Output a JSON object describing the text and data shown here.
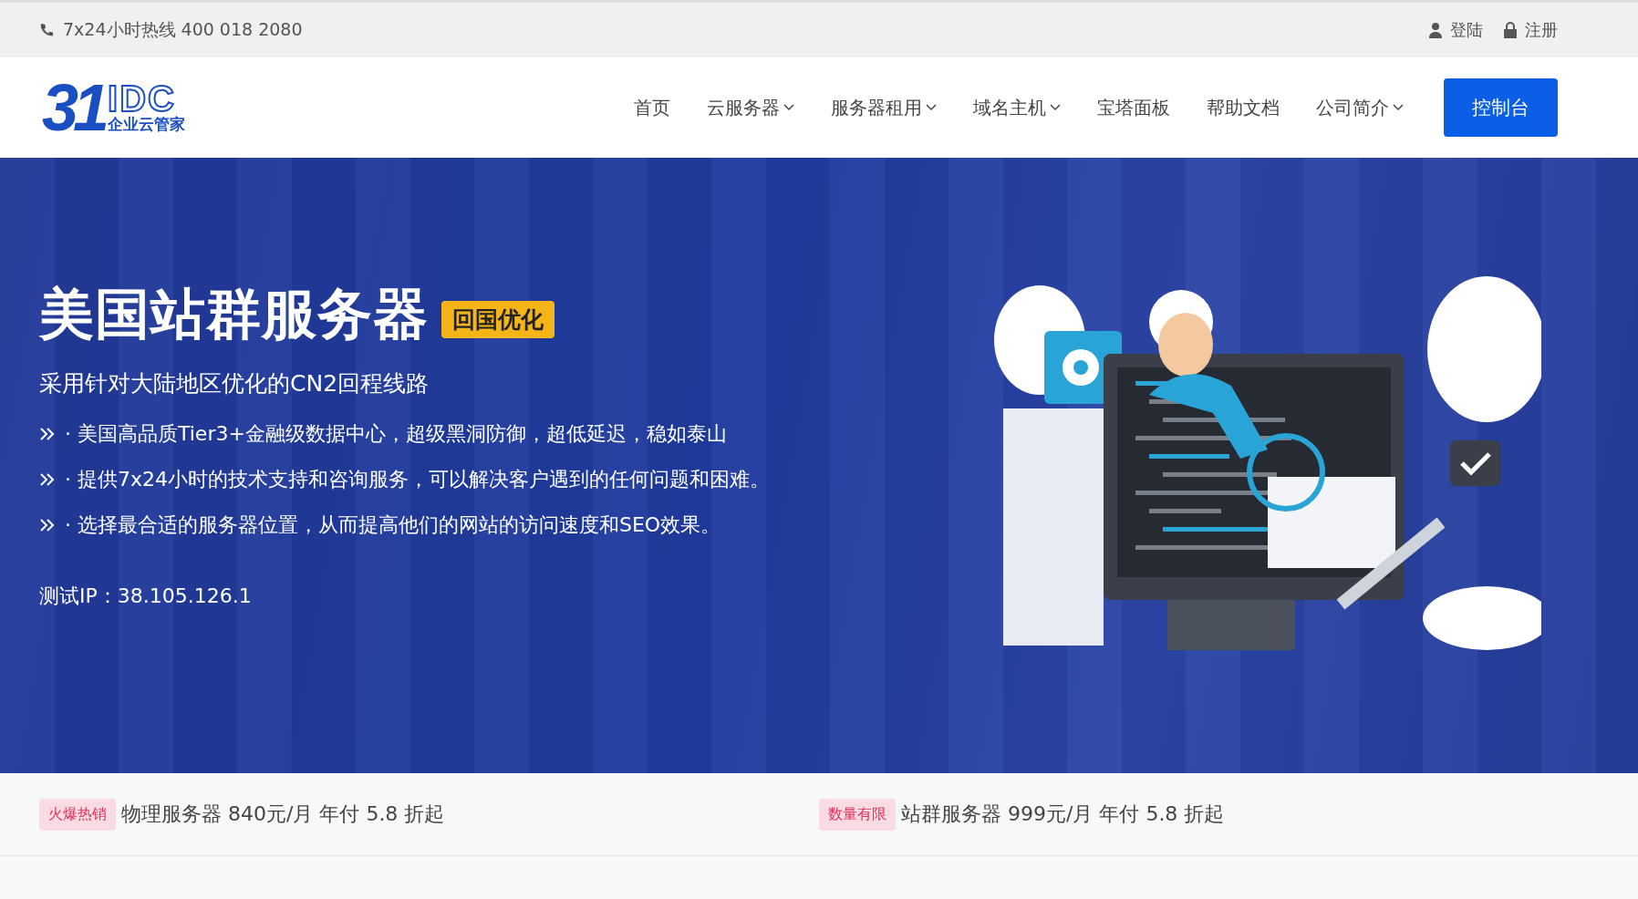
{
  "top_bar": {
    "hotline": "7x24小时热线 400 018 2080",
    "links": [
      {
        "label": "登陆",
        "kind": "user"
      },
      {
        "label": "注册",
        "kind": "lock"
      }
    ]
  },
  "header": {
    "logo": {
      "mark": "31",
      "letters": "IDC",
      "tagline": "企业云管家"
    },
    "nav": [
      {
        "label": "首页",
        "has_dropdown": false
      },
      {
        "label": "云服务器",
        "has_dropdown": true
      },
      {
        "label": "服务器租用",
        "has_dropdown": true
      },
      {
        "label": "域名主机",
        "has_dropdown": true
      },
      {
        "label": "宝塔面板",
        "has_dropdown": false
      },
      {
        "label": "帮助文档",
        "has_dropdown": false
      },
      {
        "label": "公司简介",
        "has_dropdown": true
      }
    ],
    "console_button": "控制台"
  },
  "hero": {
    "title": "美国站群服务器",
    "badge": "回国优化",
    "subtitle": "采用针对大陆地区优化的CN2回程线路",
    "bullets": [
      "· 美国高品质Tier3+金融级数据中心，超级黑洞防御，超低延迟，稳如泰山",
      "· 提供7x24小时的技术支持和咨询服务，可以解决客户遇到的任何问题和困难。",
      "· 选择最合适的服务器位置，从而提高他们的网站的访问速度和SEO效果。"
    ],
    "test_ip": "测试IP：38.105.126.1"
  },
  "promos": [
    {
      "tag": "火爆热销",
      "text": "物理服务器 840元/月 年付 5.8 折起"
    },
    {
      "tag": "数量有限",
      "text": "站群服务器 999元/月 年付 5.8 折起"
    }
  ]
}
